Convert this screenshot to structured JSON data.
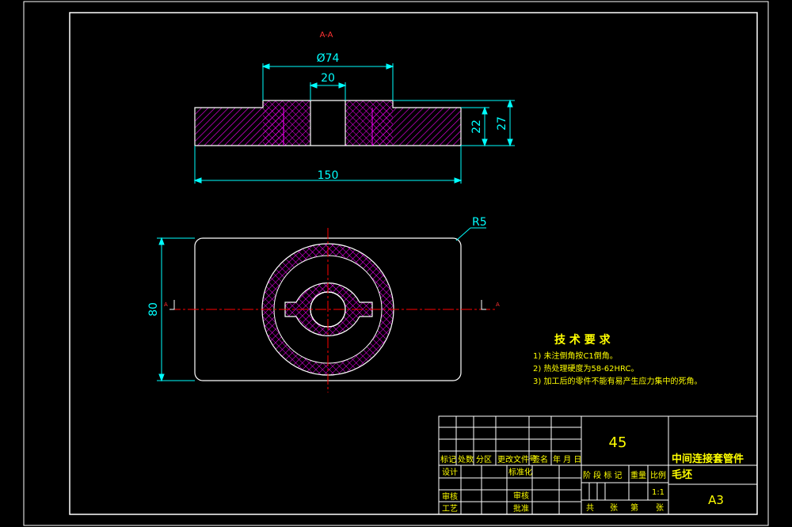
{
  "section": {
    "label": "A-A",
    "marker_left": "A",
    "marker_right": "A"
  },
  "dimensions": {
    "d74": "Ø74",
    "d20": "20",
    "d150": "150",
    "d22": "22",
    "d27": "27",
    "d80": "80",
    "r5": "R5"
  },
  "tech": {
    "title": "技 术 要 求",
    "items": [
      "1) 未注倒角按C1倒角。",
      "2) 热处理硬度为58-62HRC。",
      "3) 加工后的零件不能有易产生应力集中的死角。"
    ]
  },
  "title_block": {
    "material": "45",
    "part_name": "中间连接套管件",
    "part_sub": "毛坯",
    "sheet_size": "A3",
    "scale": "1:1",
    "row_headers": [
      "标记",
      "处数",
      "分区",
      "更改文件号",
      "签名",
      "年 月 日"
    ],
    "left_labels": [
      "设计",
      "审核",
      "工艺"
    ],
    "mid_labels": [
      "标准化",
      "",
      "审核",
      "",
      "批准"
    ],
    "stage_labels": [
      "阶 段 标 记",
      "重量",
      "比例"
    ],
    "sheet_labels": [
      "共",
      "张",
      "第",
      "张"
    ]
  },
  "colors": {
    "outline": "#ffffff",
    "dimension": "#00ffff",
    "center": "#ff0000",
    "hatch": "#ff00ff",
    "text": "#ffff00"
  }
}
